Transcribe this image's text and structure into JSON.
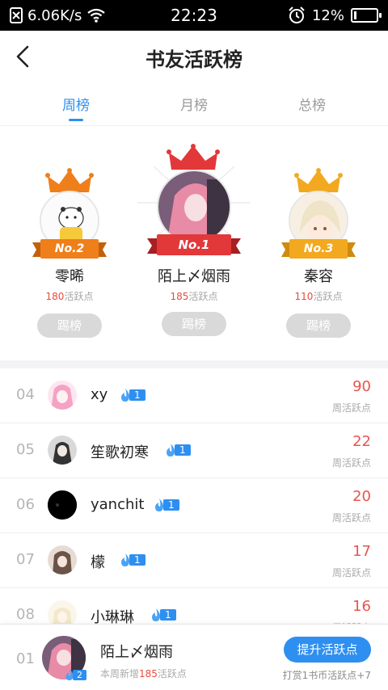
{
  "status_bar": {
    "network_speed": "6.06K/s",
    "time": "22:23",
    "battery_percent": "12%",
    "battery_level": 0.12
  },
  "header": {
    "title": "书友活跃榜"
  },
  "tabs": [
    {
      "label": "周榜",
      "active": true
    },
    {
      "label": "月榜",
      "active": false
    },
    {
      "label": "总榜",
      "active": false
    }
  ],
  "podium": {
    "first": {
      "rank_badge": "No.1",
      "name": "陌上〆烟雨",
      "points": "185",
      "points_label": "活跃点",
      "button": "踢榜"
    },
    "second": {
      "rank_badge": "No.2",
      "name": "零晞",
      "points": "180",
      "points_label": "活跃点",
      "button": "踢榜"
    },
    "third": {
      "rank_badge": "No.3",
      "name": "秦容",
      "points": "110",
      "points_label": "活跃点",
      "button": "踢榜"
    }
  },
  "list": [
    {
      "rank": "04",
      "name": "xy",
      "level": "1",
      "score": "90",
      "score_label": "周活跃点"
    },
    {
      "rank": "05",
      "name": "笙歌初寒",
      "level": "1",
      "score": "22",
      "score_label": "周活跃点"
    },
    {
      "rank": "06",
      "name": "yanchit",
      "level": "1",
      "score": "20",
      "score_label": "周活跃点"
    },
    {
      "rank": "07",
      "name": "檬",
      "level": "1",
      "score": "17",
      "score_label": "周活跃点"
    },
    {
      "rank": "08",
      "name": "小琳琳",
      "level": "1",
      "score": "16",
      "score_label": "周活跃点"
    }
  ],
  "me": {
    "rank": "01",
    "name": "陌上〆烟雨",
    "level": "2",
    "sub_prefix": "本周新增",
    "sub_points": "185",
    "sub_suffix": "活跃点",
    "button": "提升活跃点",
    "tip": "打赏1书币活跃点+7"
  },
  "colors": {
    "accent": "#2e8ff0",
    "score_red": "#e7554e",
    "gold": "#f2a91f",
    "orange": "#ef7f1a",
    "red": "#e2383a"
  }
}
